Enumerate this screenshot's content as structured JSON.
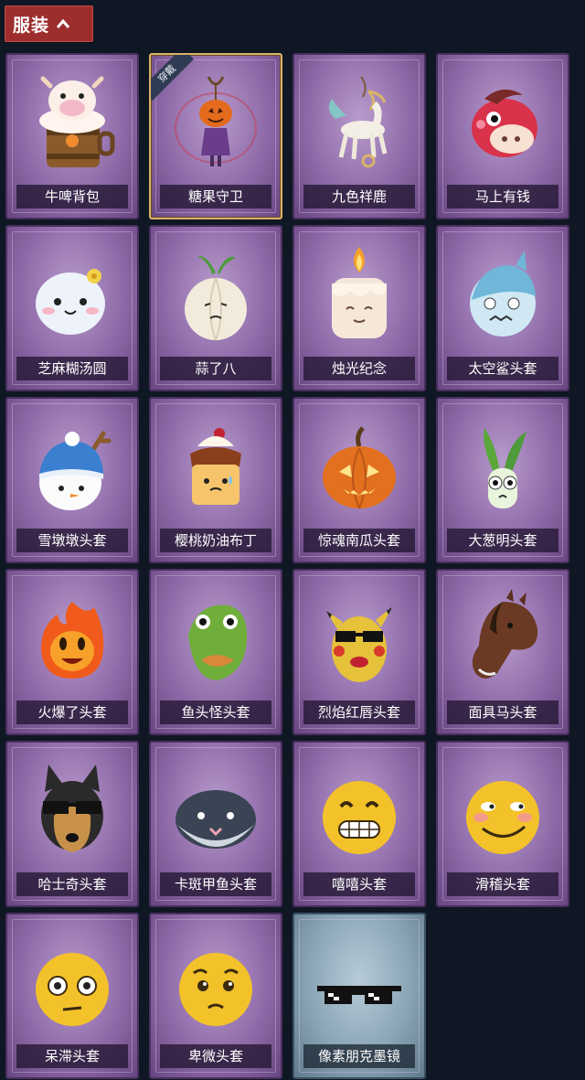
{
  "header": {
    "title": "服装",
    "icon": "chevron-up-icon"
  },
  "equipped_badge": "穿戴",
  "items": [
    {
      "name": "牛啤背包",
      "icon": "cow-beer-barrel-icon",
      "tint": "purple"
    },
    {
      "name": "糖果守卫",
      "icon": "pumpkin-scarecrow-icon",
      "tint": "purple",
      "equipped": true
    },
    {
      "name": "九色祥鹿",
      "icon": "deer-pendant-icon",
      "tint": "purple"
    },
    {
      "name": "马上有钱",
      "icon": "red-horse-head-icon",
      "tint": "purple"
    },
    {
      "name": "芝麻糊汤圆",
      "icon": "rice-ball-icon",
      "tint": "purple"
    },
    {
      "name": "蒜了八",
      "icon": "garlic-icon",
      "tint": "purple"
    },
    {
      "name": "烛光纪念",
      "icon": "candle-icon",
      "tint": "purple"
    },
    {
      "name": "太空鲨头套",
      "icon": "shark-head-icon",
      "tint": "purple"
    },
    {
      "name": "雪墩墩头套",
      "icon": "snowman-head-icon",
      "tint": "purple"
    },
    {
      "name": "樱桃奶油布丁",
      "icon": "pudding-icon",
      "tint": "purple"
    },
    {
      "name": "惊魂南瓜头套",
      "icon": "jack-o-lantern-icon",
      "tint": "purple"
    },
    {
      "name": "大葱明头套",
      "icon": "scallion-head-icon",
      "tint": "purple"
    },
    {
      "name": "火爆了头套",
      "icon": "fire-head-icon",
      "tint": "purple"
    },
    {
      "name": "鱼头怪头套",
      "icon": "fish-head-icon",
      "tint": "purple"
    },
    {
      "name": "烈焰红唇头套",
      "icon": "pikachu-head-icon",
      "tint": "purple"
    },
    {
      "name": "面具马头套",
      "icon": "horse-mask-icon",
      "tint": "purple"
    },
    {
      "name": "哈士奇头套",
      "icon": "husky-head-icon",
      "tint": "purple"
    },
    {
      "name": "卡斑甲鱼头套",
      "icon": "whale-head-icon",
      "tint": "purple"
    },
    {
      "name": "嘻嘻头套",
      "icon": "grin-emoji-icon",
      "tint": "purple"
    },
    {
      "name": "滑稽头套",
      "icon": "smirk-emoji-icon",
      "tint": "purple"
    },
    {
      "name": "呆滞头套",
      "icon": "dazed-emoji-icon",
      "tint": "purple"
    },
    {
      "name": "卑微头套",
      "icon": "pleading-emoji-icon",
      "tint": "purple"
    },
    {
      "name": "像素朋克墨镜",
      "icon": "pixel-sunglasses-icon",
      "tint": "blue"
    }
  ]
}
